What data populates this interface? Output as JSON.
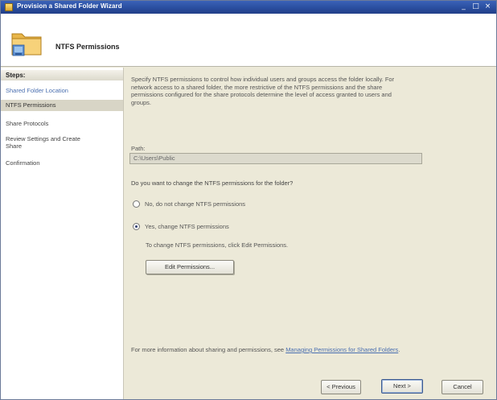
{
  "window": {
    "title": "Provision a Shared Folder Wizard",
    "controls": {
      "minimize": "_",
      "maximize": "□",
      "close": "×"
    }
  },
  "header": {
    "heading": "NTFS Permissions"
  },
  "steps": {
    "title": "Steps:",
    "items": [
      {
        "label": "Shared Folder Location",
        "state": "link"
      },
      {
        "label": "NTFS Permissions",
        "state": "current"
      },
      {
        "label": "Share Protocols",
        "state": "plain"
      },
      {
        "label": "Review Settings and Create Share",
        "state": "plain"
      },
      {
        "label": "Confirmation",
        "state": "plain"
      }
    ]
  },
  "main": {
    "description": "Specify NTFS permissions to control how individual users and groups access the folder locally. For network access to a shared folder, the more restrictive of the NTFS permissions and the share permissions configured for the share protocols determine the level of access granted to users and groups.",
    "path_label": "Path:",
    "path_value": "C:\\Users\\Public",
    "question": "Do you want to change the NTFS permissions for the folder?",
    "options": [
      {
        "label": "No, do not change NTFS permissions",
        "checked": false
      },
      {
        "label": "Yes, change NTFS permissions",
        "checked": true
      }
    ],
    "hint": "To change NTFS permissions, click Edit Permissions.",
    "edit_button": "Edit Permissions...",
    "more_info_prefix": "For more information about sharing and permissions, see ",
    "more_info_link": "Managing Permissions for Shared Folders",
    "more_info_suffix": "."
  },
  "footer": {
    "previous": "< Previous",
    "next": "Next >",
    "cancel": "Cancel"
  },
  "colors": {
    "title_bar": "#2a4e9f",
    "link": "#4a6fb0",
    "current_step_bg": "#d8d5c6"
  }
}
